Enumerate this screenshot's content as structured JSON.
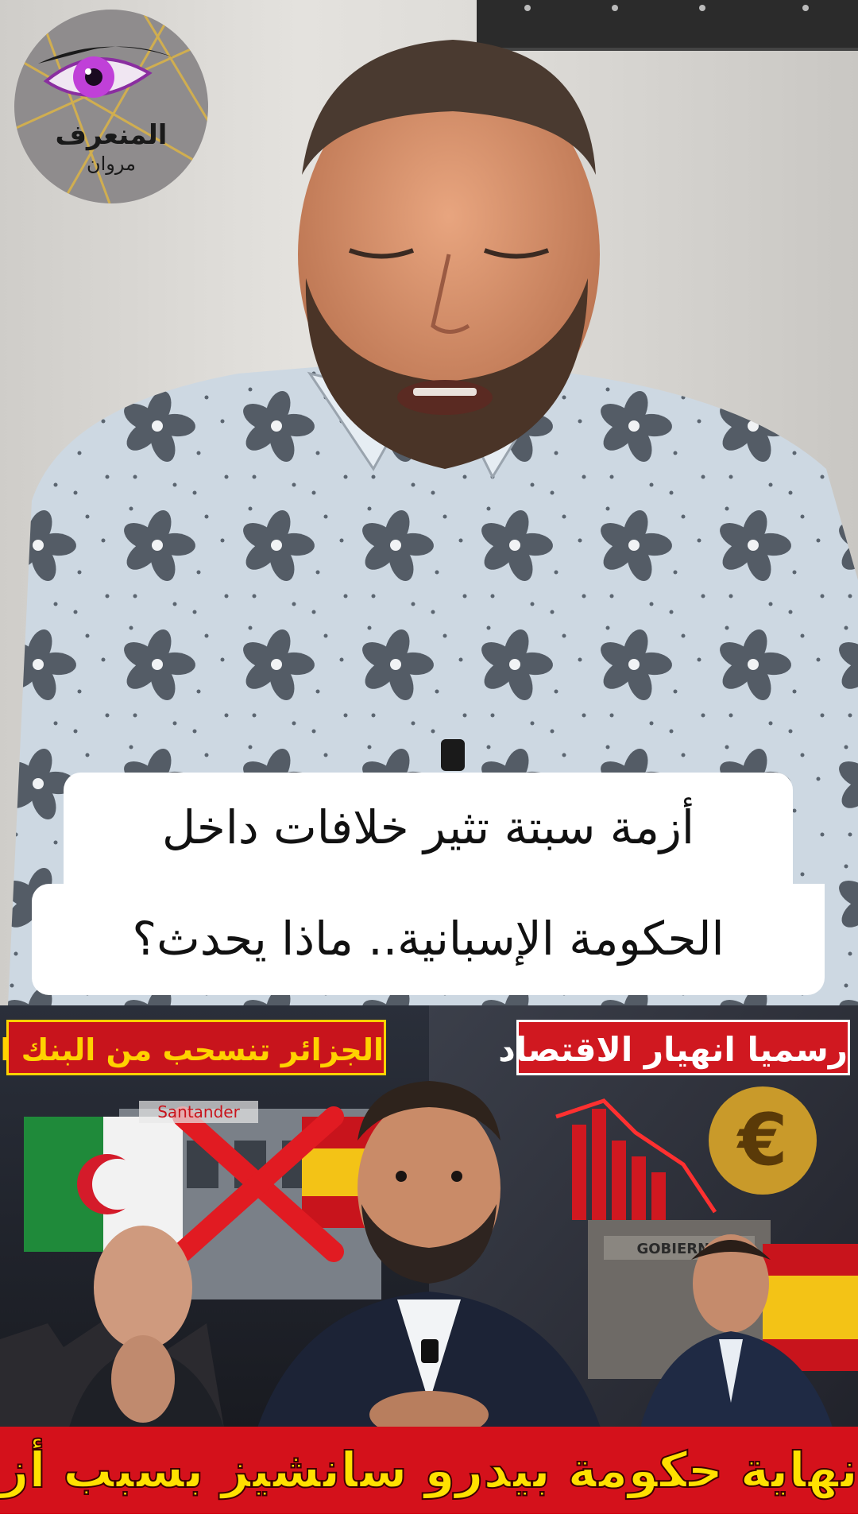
{
  "logo": {
    "name": "المنعرف",
    "subtitle": "مروان"
  },
  "caption": {
    "line1": "أزمة سبتة تثير خلافات داخل",
    "line2": "الحكومة الإسبانية.. ماذا يحدث؟"
  },
  "thumbnail": {
    "headline_left": "الجزائر تنسحب من البنك الإسباني",
    "headline_right": "رسميا انهيار الاقتصاد",
    "bottom_banner": "نهاية حكومة بيدرو سانشيز بسبب أزمة سبتة",
    "bank_sign": "Santander",
    "building_sign": "GOBIERNO",
    "currency_symbol": "€"
  },
  "colors": {
    "banner_red": "#d4111b",
    "banner_yellow": "#ffe100",
    "logo_circle": "#8f8c8d",
    "logo_eye": "#c040d8"
  }
}
